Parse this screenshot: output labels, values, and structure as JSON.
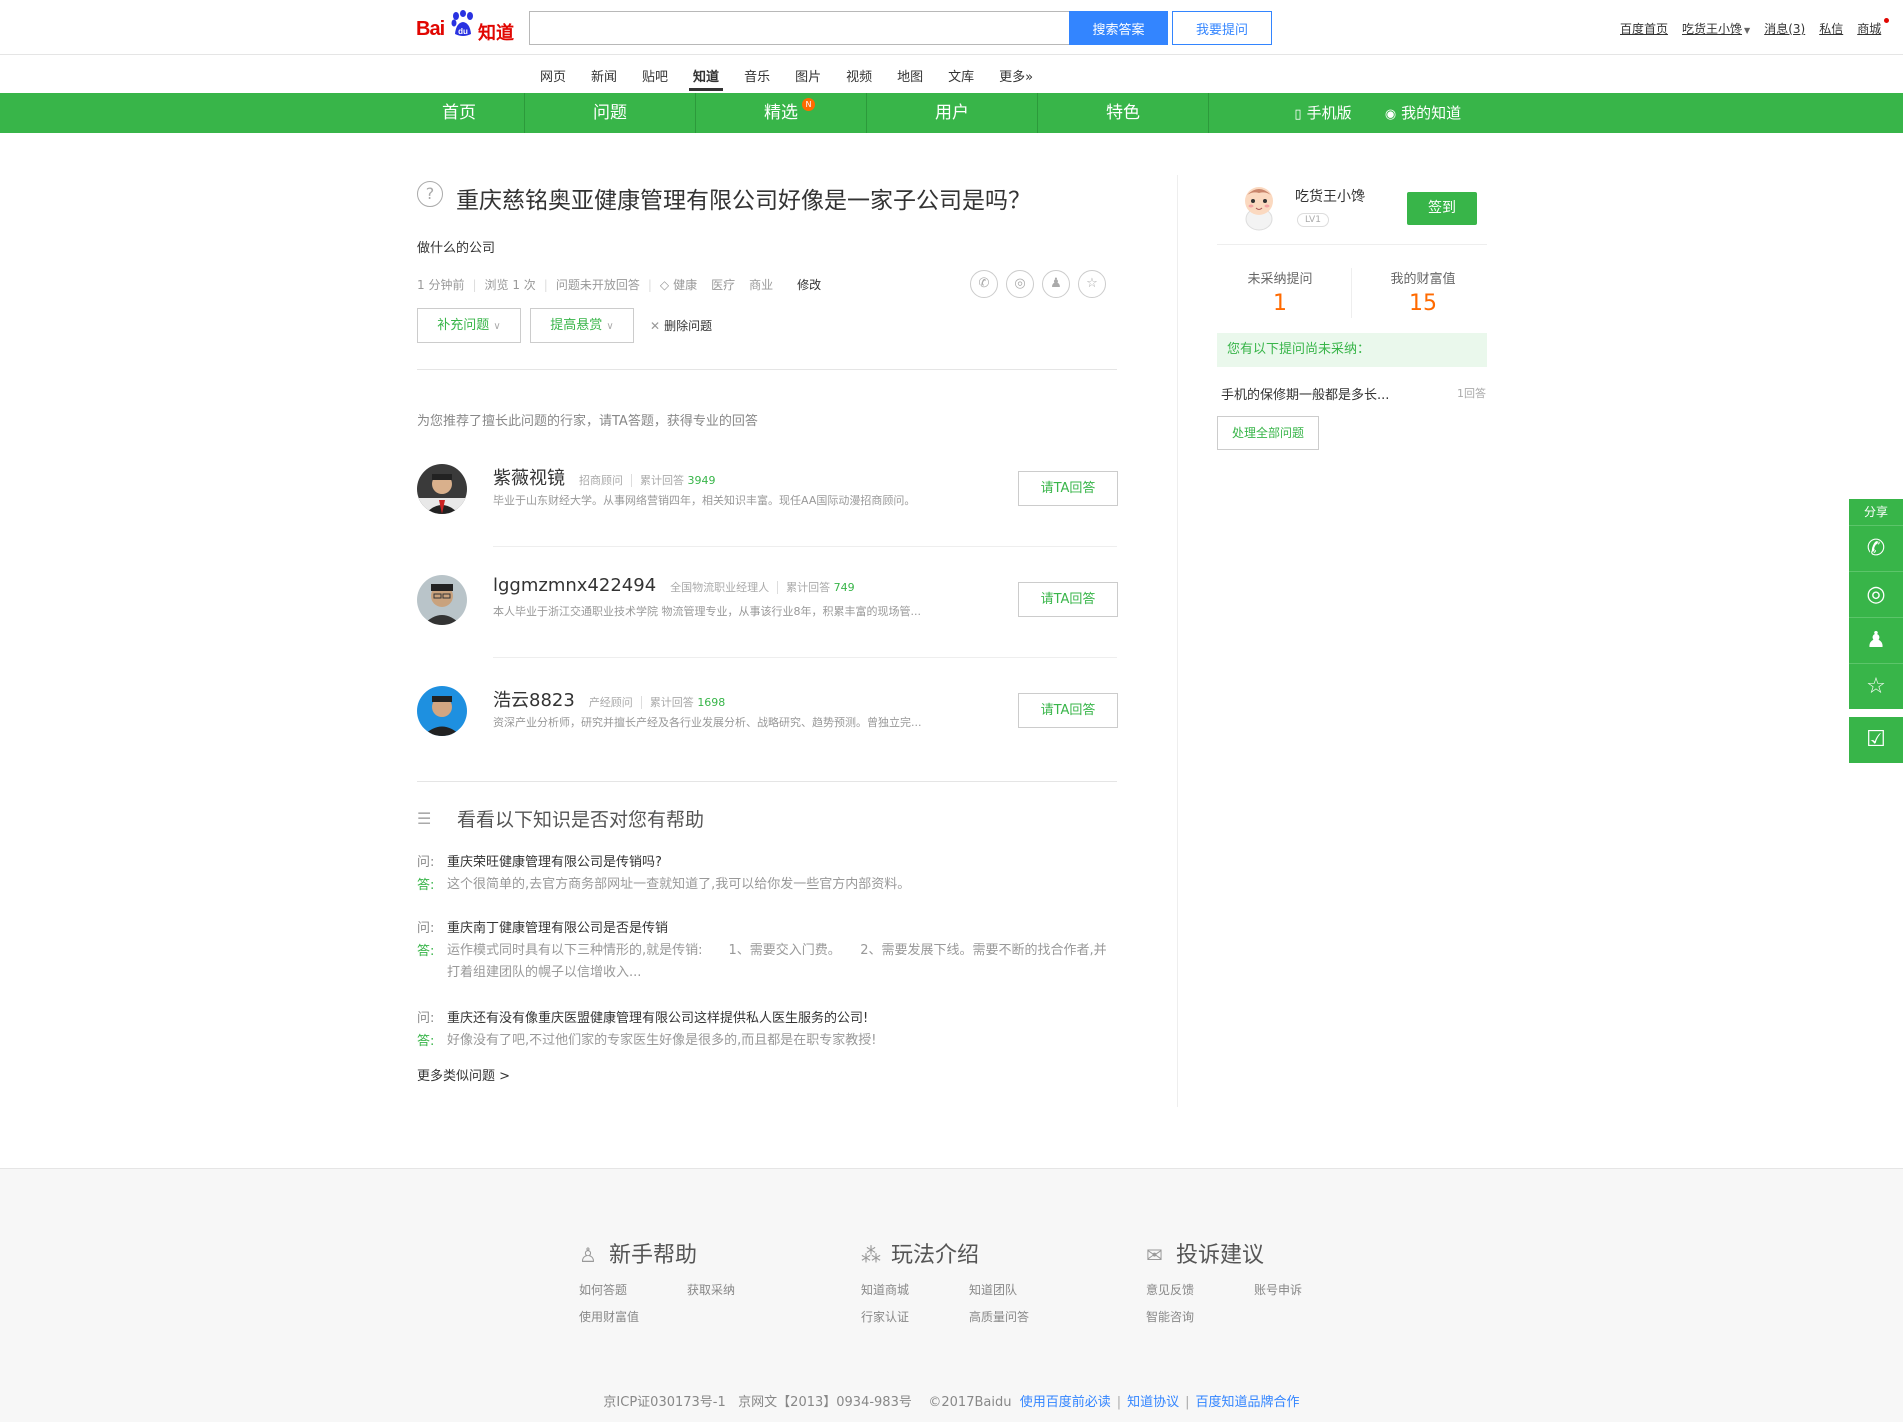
{
  "header": {
    "logo_bai": "Bai",
    "logo_du": "du",
    "logo_zhidao": "知道",
    "search_value": "",
    "search_button": "搜索答案",
    "ask_button": "我要提问",
    "user_links": [
      "百度首页",
      "吃货王小馋",
      "消息(3)",
      "私信",
      "商城"
    ]
  },
  "channels": [
    "网页",
    "新闻",
    "贴吧",
    "知道",
    "音乐",
    "图片",
    "视频",
    "地图",
    "文库",
    "更多»"
  ],
  "greenbar": {
    "items": [
      "首页",
      "问题",
      "精选",
      "用户",
      "特色"
    ],
    "badge": "N",
    "mobile": "手机版",
    "my_zhidao": "我的知道"
  },
  "question": {
    "title": "重庆慈铭奥亚健康管理有限公司好像是一家子公司是吗？",
    "description": "做什么的公司",
    "time": "1 分钟前",
    "views": "浏览 1 次",
    "status": "问题未开放回答",
    "tags": [
      "健康",
      "医疗",
      "商业"
    ],
    "edit": "修改",
    "supplement_button": "补充问题",
    "reward_button": "提高悬赏",
    "delete": "删除问题"
  },
  "recommend": {
    "title": "为您推荐了擅长此问题的行家，请TA答题，获得专业的回答",
    "ask_label": "请TA回答",
    "count_label": "累计回答",
    "experts": [
      {
        "name": "紫薇视镜",
        "title": "招商顾问",
        "count": "3949",
        "desc": "毕业于山东财经大学。从事网络营销四年，相关知识丰富。现任AA国际动漫招商顾问。"
      },
      {
        "name": "lggmzmnx422494",
        "title": "全国物流职业经理人",
        "count": "749",
        "desc": "本人毕业于浙江交通职业技术学院 物流管理专业，从事该行业8年，积累丰富的现场管..."
      },
      {
        "name": "浩云8823",
        "title": "产经顾问",
        "count": "1698",
        "desc": "资深产业分析师，研究并擅长产经及各行业发展分析、战略研究、趋势预测。曾独立完..."
      }
    ]
  },
  "help": {
    "title": "看看以下知识是否对您有帮助",
    "q_label": "问:",
    "a_label": "答:",
    "items": [
      {
        "q": "重庆荣旺健康管理有限公司是传销吗?",
        "a": "这个很简单的,去官方商务部网址一查就知道了,我可以给你发一些官方内部资料。"
      },
      {
        "q": "重庆南丁健康管理有限公司是否是传销",
        "a": "运作模式同时具有以下三种情形的,就是传销:　　1、需要交入门费。　　2、需要发展下线。需要不断的找合作者,并打着组建团队的幌子以信增收入..."
      },
      {
        "q": "重庆还有没有像重庆医盟健康管理有限公司这样提供私人医生服务的公司!",
        "a": "好像没有了吧,不过他们家的专家医生好像是很多的,而且都是在职专家教授!"
      }
    ],
    "more": "更多类似问题 >"
  },
  "sidebar": {
    "username": "吃货王小馋",
    "level": "LV1",
    "signin": "签到",
    "unadopted_label": "未采纳提问",
    "unadopted_value": "1",
    "wealth_label": "我的财富值",
    "wealth_value": "15",
    "pending_notice": "您有以下提问尚未采纳：",
    "pending_question": "手机的保修期一般都是多长...",
    "pending_count": "1回答",
    "handle_all": "处理全部问题"
  },
  "float_share": {
    "title": "分享"
  },
  "footer": {
    "cols": [
      {
        "title": "新手帮助",
        "icon": "user-icon",
        "links": [
          "如何答题",
          "获取采纳",
          "使用财富值"
        ]
      },
      {
        "title": "玩法介绍",
        "icon": "share-nodes-icon",
        "links": [
          "知道商城",
          "知道团队",
          "行家认证",
          "高质量问答"
        ]
      },
      {
        "title": "投诉建议",
        "icon": "mail-icon",
        "links": [
          "意见反馈",
          "账号申诉",
          "智能咨询"
        ]
      }
    ],
    "icp": "京ICP证030173号-1",
    "wenwang": "京网文【2013】0934-983号",
    "copy": "©2017Baidu",
    "links": [
      "使用百度前必读",
      "知道协议",
      "百度知道品牌合作"
    ]
  }
}
